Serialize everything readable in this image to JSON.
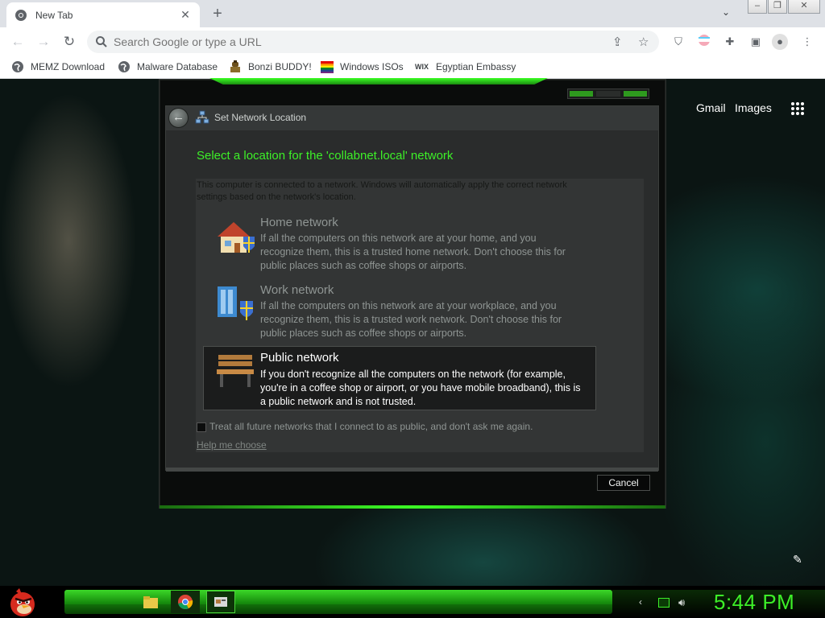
{
  "browser": {
    "tab_title": "New Tab",
    "omnibox_placeholder": "Search Google or type a URL",
    "bookmarks": [
      {
        "label": "MEMZ Download",
        "icon": "globe-icon"
      },
      {
        "label": "Malware Database",
        "icon": "globe-icon"
      },
      {
        "label": "Bonzi BUDDY!",
        "icon": "bonzi-icon"
      },
      {
        "label": "Windows ISOs",
        "icon": "windows-flag-icon"
      },
      {
        "label": "Egyptian Embassy",
        "icon": "wix-icon"
      }
    ],
    "wix_logo_text": "WIX"
  },
  "newtab": {
    "gmail": "Gmail",
    "images": "Images"
  },
  "dialog": {
    "header_title": "Set Network Location",
    "main_title": "Select a location for the 'collabnet.local' network",
    "intro": "This computer is connected to a network. Windows will automatically apply the correct network settings based on the network's location.",
    "options": [
      {
        "name": "Home network",
        "desc": "If all the computers on this network are at your home, and you recognize them, this is a trusted home network.  Don't choose this for public places such as coffee shops or airports.",
        "icon": "home-network-icon",
        "selected": false
      },
      {
        "name": "Work network",
        "desc": "If all the computers on this network are at your workplace, and you recognize them, this is a trusted work network.  Don't choose this for public places such as coffee shops or airports.",
        "icon": "work-network-icon",
        "selected": false
      },
      {
        "name": "Public network",
        "desc": "If you don't recognize all the computers on the network (for example, you're in a coffee shop or airport, or you have mobile broadband), this is a public network and is not trusted.",
        "icon": "public-bench-icon",
        "selected": true
      }
    ],
    "checkbox_label": "Treat all future networks that I connect to as public, and don't ask me again.",
    "checkbox_checked": false,
    "help_link": "Help me choose",
    "cancel_label": "Cancel"
  },
  "taskbar": {
    "clock": "5:44 PM",
    "apps": [
      "folder-icon",
      "chrome-icon",
      "network-dialog-icon"
    ],
    "accent": "#3df028"
  }
}
